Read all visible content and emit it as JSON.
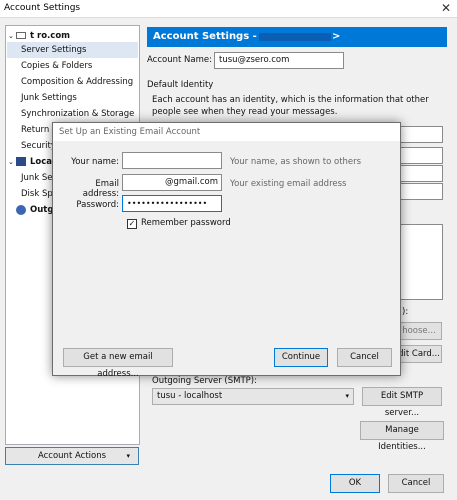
{
  "window": {
    "title": "Account Settings",
    "close_glyph": "✕"
  },
  "tree": {
    "items": [
      {
        "label": "t            ro.com",
        "level": 0,
        "selected": false
      },
      {
        "label": "Server Settings",
        "level": 1,
        "selected": true
      },
      {
        "label": "Copies & Folders",
        "level": 1,
        "selected": false
      },
      {
        "label": "Composition & Addressing",
        "level": 1,
        "selected": false
      },
      {
        "label": "Junk Settings",
        "level": 1,
        "selected": false
      },
      {
        "label": "Synchronization & Storage",
        "level": 1,
        "selected": false
      },
      {
        "label": "Return R",
        "level": 1,
        "selected": false
      },
      {
        "label": "Security",
        "level": 1,
        "selected": false
      },
      {
        "label": "Local",
        "level": 0,
        "selected": false
      },
      {
        "label": "Junk Set",
        "level": 1,
        "selected": false
      },
      {
        "label": "Disk Spa",
        "level": 1,
        "selected": false
      },
      {
        "label": "Outgo",
        "level": 0,
        "selected": false
      }
    ],
    "account_actions_label": "Account Actions"
  },
  "pane": {
    "header": "Account Settings -",
    "header_suffix": ">",
    "account_name_label": "Account Name:",
    "account_name_value": "tusu@zsero.com",
    "default_identity_label": "Default Identity",
    "identity_desc": "Each account has an identity, which is the information that other people see when they read your messages.",
    "choose_label": "hoose...",
    "edit_card_label": "dit Card...",
    "paren_text": "):",
    "outgoing_label": "Outgoing Server (SMTP):",
    "outgoing_value": "tusu - localhost",
    "edit_smtp_label": "Edit SMTP server...",
    "manage_identities_label": "Manage Identities...",
    "ok_label": "OK",
    "cancel_label": "Cancel"
  },
  "modal": {
    "title": "Set Up an Existing Email Account",
    "your_name_label": "Your name:",
    "your_name_value": "",
    "your_name_hint": "Your name, as shown to others",
    "email_label": "Email address:",
    "email_value": "@gmail.com",
    "email_hint": "Your existing email address",
    "password_label": "Password:",
    "password_value": "•••••••••••••••••",
    "remember_label": "Remember password",
    "remember_checked": "✓",
    "new_email_label": "Get a new email address...",
    "continue_label": "Continue",
    "cancel_label": "Cancel"
  }
}
